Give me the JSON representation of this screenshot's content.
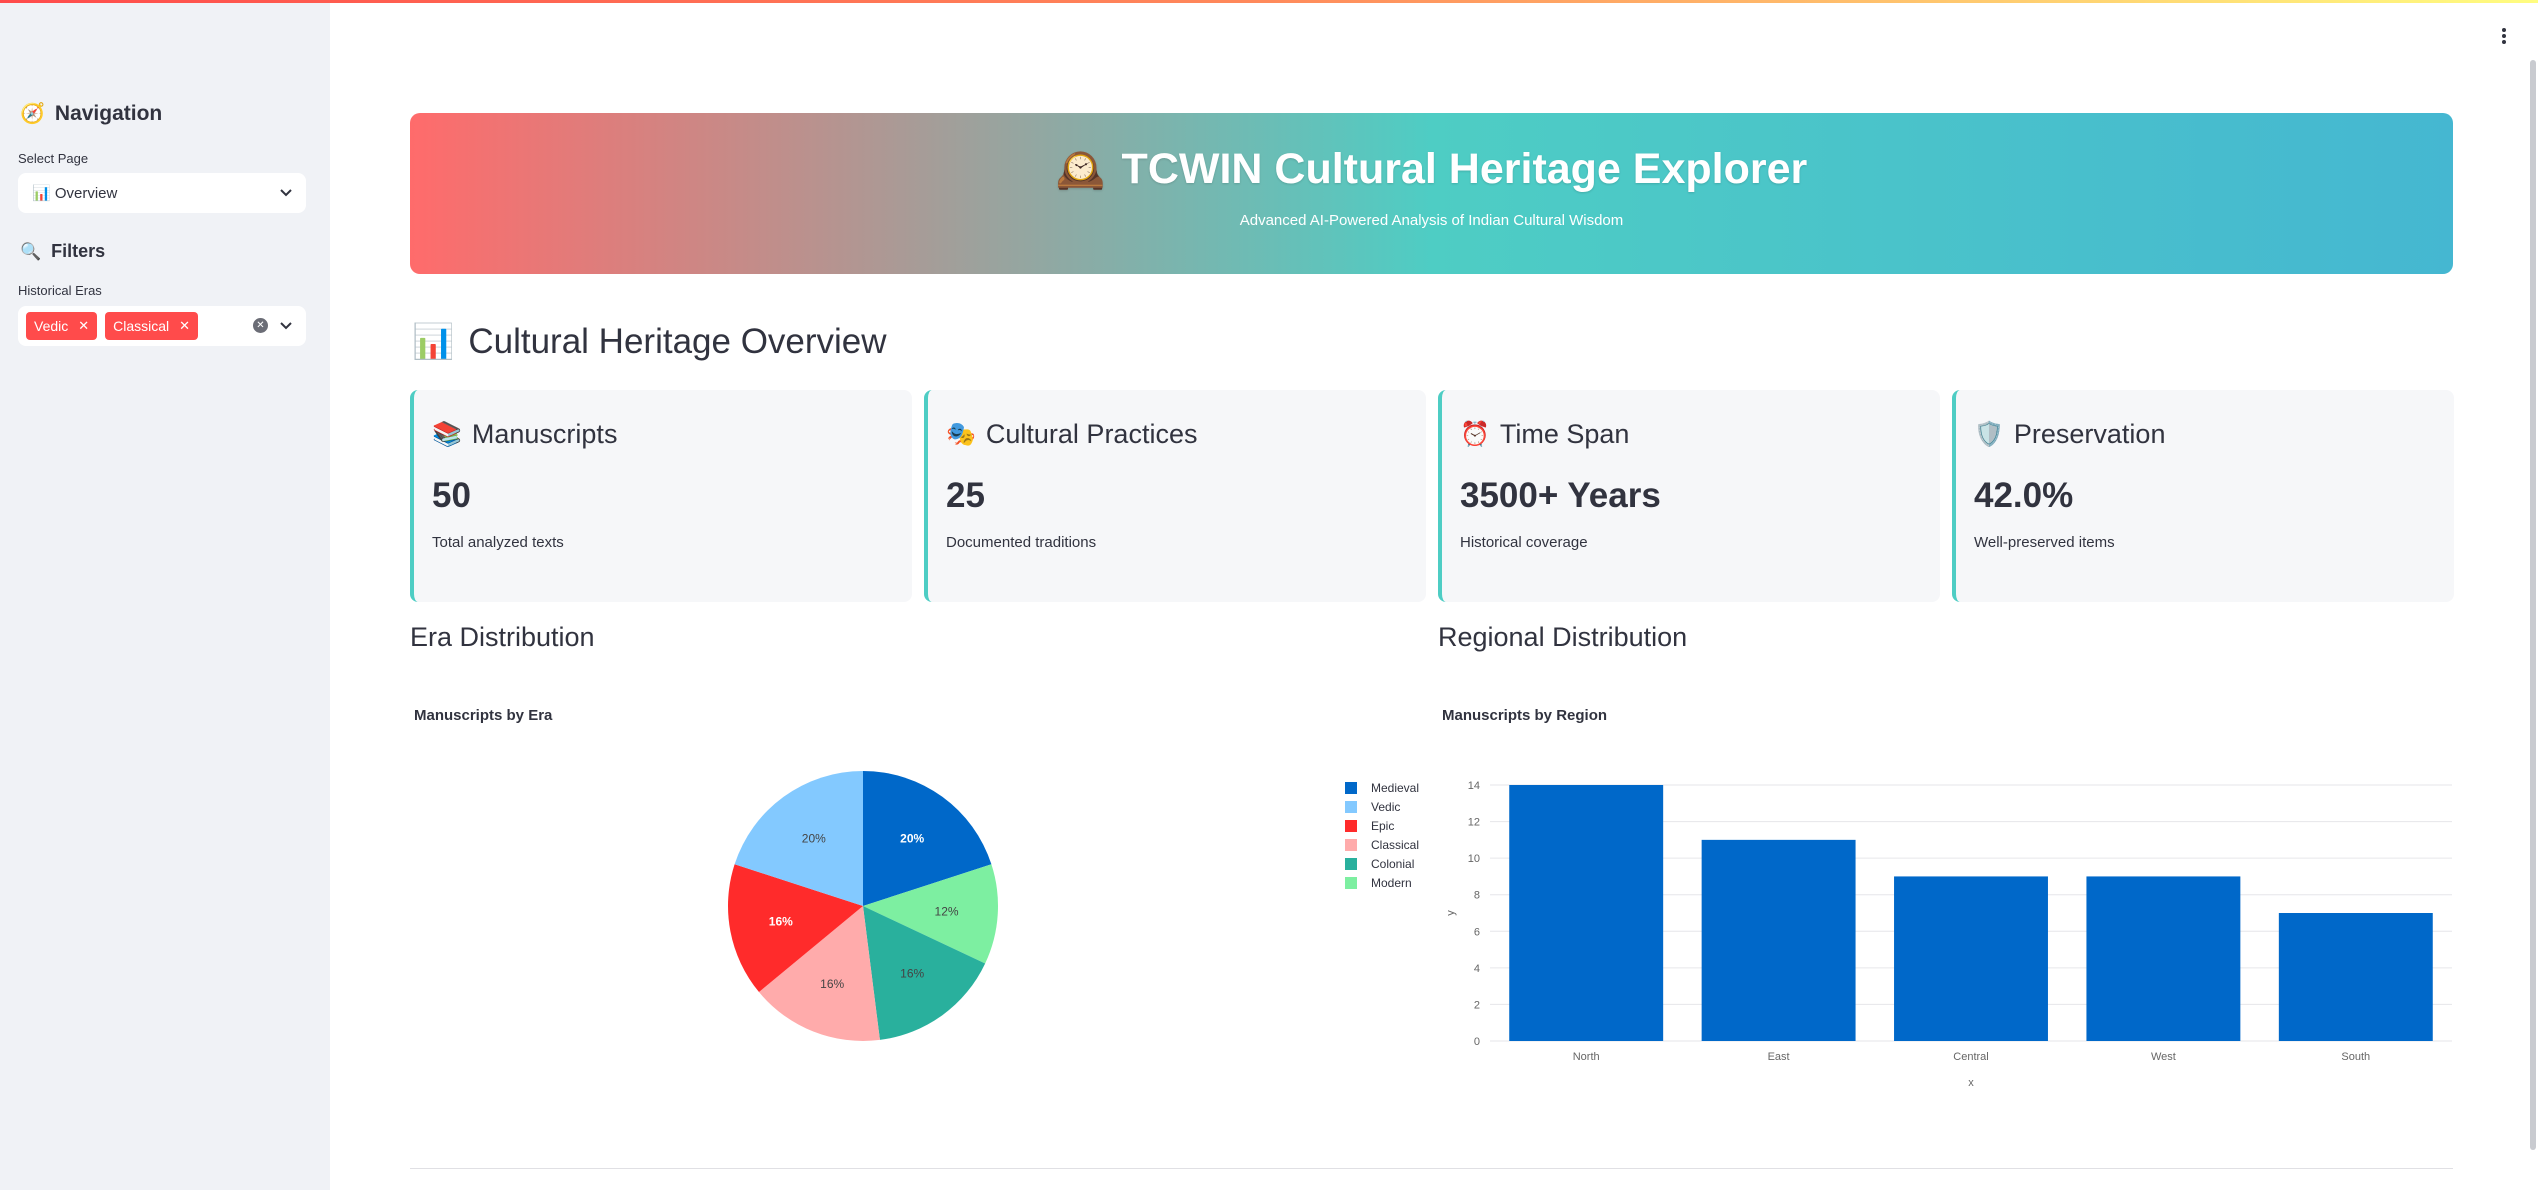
{
  "sidebar": {
    "nav_icon": "🧭",
    "nav_heading": "Navigation",
    "select_label": "Select Page",
    "select_value": "📊 Overview",
    "filters_icon": "🔍",
    "filters_heading": "Filters",
    "eras_label": "Historical Eras",
    "selected_eras": [
      "Vedic",
      "Classical"
    ]
  },
  "header": {
    "icon": "🕰️",
    "title": "TCWIN Cultural Heritage Explorer",
    "subtitle": "Advanced AI-Powered Analysis of Indian Cultural Wisdom"
  },
  "overview": {
    "icon": "📊",
    "title": "Cultural Heritage Overview"
  },
  "metrics": [
    {
      "icon": "📚",
      "title": "Manuscripts",
      "value": "50",
      "desc": "Total analyzed texts"
    },
    {
      "icon": "🎭",
      "title": "Cultural Practices",
      "value": "25",
      "desc": "Documented traditions"
    },
    {
      "icon": "⏰",
      "title": "Time Span",
      "value": "3500+ Years",
      "desc": "Historical coverage"
    },
    {
      "icon": "🛡️",
      "title": "Preservation",
      "value": "42.0%",
      "desc": "Well-preserved items"
    }
  ],
  "sections": {
    "era": "Era Distribution",
    "region": "Regional Distribution"
  },
  "colors": {
    "accent": "#ff4b4b",
    "card_border": "#4ecdc4",
    "bar": "#0068c9"
  },
  "chart_data": [
    {
      "type": "pie",
      "title": "Manuscripts by Era",
      "labels": [
        "Medieval",
        "Vedic",
        "Epic",
        "Classical",
        "Colonial",
        "Modern"
      ],
      "legend_labels": [
        "Medieval",
        "Vedic",
        "Epic",
        "Classical",
        "Colonial",
        "Modern"
      ],
      "slices": [
        {
          "name": "Medieval",
          "value": 20,
          "label": "20%",
          "color": "#0068c9"
        },
        {
          "name": "Modern",
          "value": 12,
          "label": "12%",
          "color": "#7defa1"
        },
        {
          "name": "Colonial",
          "value": 16,
          "label": "16%",
          "color": "#29b09d"
        },
        {
          "name": "Classical",
          "value": 16,
          "label": "16%",
          "color": "#ffabab"
        },
        {
          "name": "Epic",
          "value": 16,
          "label": "16%",
          "color": "#ff2b2b"
        },
        {
          "name": "Vedic",
          "value": 20,
          "label": "20%",
          "color": "#83c9ff"
        }
      ],
      "legend_colors": [
        "#0068c9",
        "#83c9ff",
        "#ff2b2b",
        "#ffabab",
        "#29b09d",
        "#7defa1"
      ],
      "legend": "right"
    },
    {
      "type": "bar",
      "title": "Manuscripts by Region",
      "categories": [
        "North",
        "East",
        "Central",
        "West",
        "South"
      ],
      "values": [
        14,
        11,
        9,
        9,
        7
      ],
      "xlabel": "x",
      "ylabel": "y",
      "ylim": [
        0,
        14
      ],
      "yticks": [
        0,
        2,
        4,
        6,
        8,
        10,
        12,
        14
      ],
      "grid": true
    }
  ]
}
